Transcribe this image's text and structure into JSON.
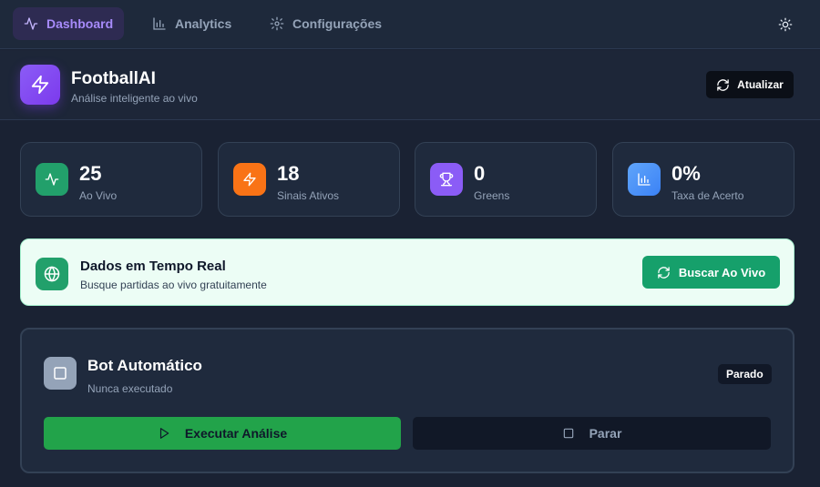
{
  "nav": {
    "items": [
      {
        "label": "Dashboard",
        "icon": "activity-icon",
        "active": true
      },
      {
        "label": "Analytics",
        "icon": "bar-chart-icon",
        "active": false
      },
      {
        "label": "Configurações",
        "icon": "gear-icon",
        "active": false
      }
    ],
    "theme_icon": "sun-icon"
  },
  "header": {
    "title": "FootballAI",
    "subtitle": "Análise inteligente ao vivo",
    "refresh_label": "Atualizar"
  },
  "stats": [
    {
      "value": "25",
      "label": "Ao Vivo",
      "icon": "activity-icon",
      "color": "#22a06b"
    },
    {
      "value": "18",
      "label": "Sinais Ativos",
      "icon": "zap-icon",
      "color": "#f97316"
    },
    {
      "value": "0",
      "label": "Greens",
      "icon": "trophy-icon",
      "color": "#8b5cf6"
    },
    {
      "value": "0%",
      "label": "Taxa de Acerto",
      "icon": "bar-chart-icon",
      "color": "#3b82f6"
    }
  ],
  "realtime": {
    "title": "Dados em Tempo Real",
    "subtitle": "Busque partidas ao vivo gratuitamente",
    "button_label": "Buscar Ao Vivo"
  },
  "bot": {
    "title": "Bot Automático",
    "subtitle": "Nunca executado",
    "status": "Parado",
    "run_label": "Executar Análise",
    "stop_label": "Parar"
  },
  "colors": {
    "accent": "#8b5cf6",
    "success": "#22a34a",
    "background": "#1a2233"
  }
}
